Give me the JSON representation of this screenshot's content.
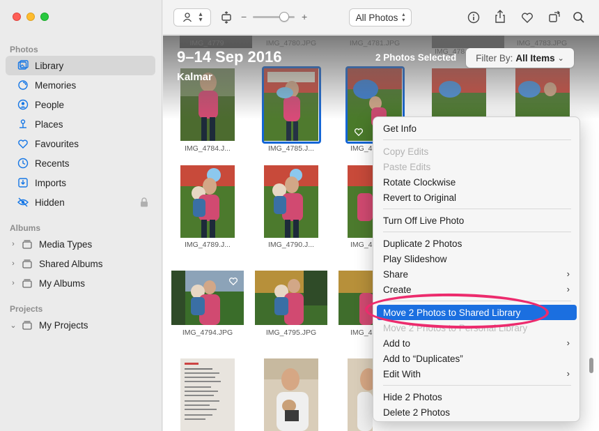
{
  "sidebar": {
    "sections": {
      "photos": "Photos",
      "albums": "Albums",
      "projects": "Projects"
    },
    "items": [
      {
        "label": "Library",
        "icon": "library-icon"
      },
      {
        "label": "Memories",
        "icon": "memories-icon"
      },
      {
        "label": "People",
        "icon": "people-icon"
      },
      {
        "label": "Places",
        "icon": "places-icon"
      },
      {
        "label": "Favourites",
        "icon": "heart-icon"
      },
      {
        "label": "Recents",
        "icon": "clock-icon"
      },
      {
        "label": "Imports",
        "icon": "import-icon"
      },
      {
        "label": "Hidden",
        "icon": "eye-slash-icon"
      }
    ],
    "albums": [
      {
        "label": "Media Types"
      },
      {
        "label": "Shared Albums"
      },
      {
        "label": "My Albums"
      }
    ],
    "projects": [
      {
        "label": "My Projects"
      }
    ]
  },
  "toolbar": {
    "view_select": "All Photos",
    "zoom_minus": "−",
    "zoom_plus": "+"
  },
  "grid": {
    "date_title": "9–14 Sep 2016",
    "location": "Kalmar",
    "selected_count": "2 Photos Selected",
    "filter_label": "Filter By:",
    "filter_value": "All Items",
    "top_row_names": [
      "IMG_4779",
      "IMG_4780.JPG",
      "IMG_4781.JPG",
      "IMG_478",
      "IMG_4783.JPG"
    ],
    "row1": [
      "IMG_4784.J...",
      "IMG_4785.J...",
      "IMG_4"
    ],
    "row2": [
      "IMG_4789.J...",
      "IMG_4790.J...",
      "IMG_4"
    ],
    "row3": [
      "IMG_4794.JPG",
      "IMG_4795.JPG",
      "IMG_4"
    ]
  },
  "context_menu": {
    "get_info": "Get Info",
    "copy_edits": "Copy Edits",
    "paste_edits": "Paste Edits",
    "rotate_clockwise": "Rotate Clockwise",
    "revert_to_original": "Revert to Original",
    "turn_off_live_photo": "Turn Off Live Photo",
    "duplicate": "Duplicate 2 Photos",
    "play_slideshow": "Play Slideshow",
    "share": "Share",
    "create": "Create",
    "move_to_shared": "Move 2 Photos to Shared Library",
    "move_to_personal": "Move 2 Photos to Personal Library",
    "add_to": "Add to",
    "add_to_duplicates": "Add to “Duplicates”",
    "edit_with": "Edit With",
    "hide": "Hide 2 Photos",
    "delete": "Delete 2 Photos"
  },
  "colors": {
    "accent": "#1b6fe0",
    "selection_border": "#1366d6",
    "annotation": "#ec2b6d"
  }
}
